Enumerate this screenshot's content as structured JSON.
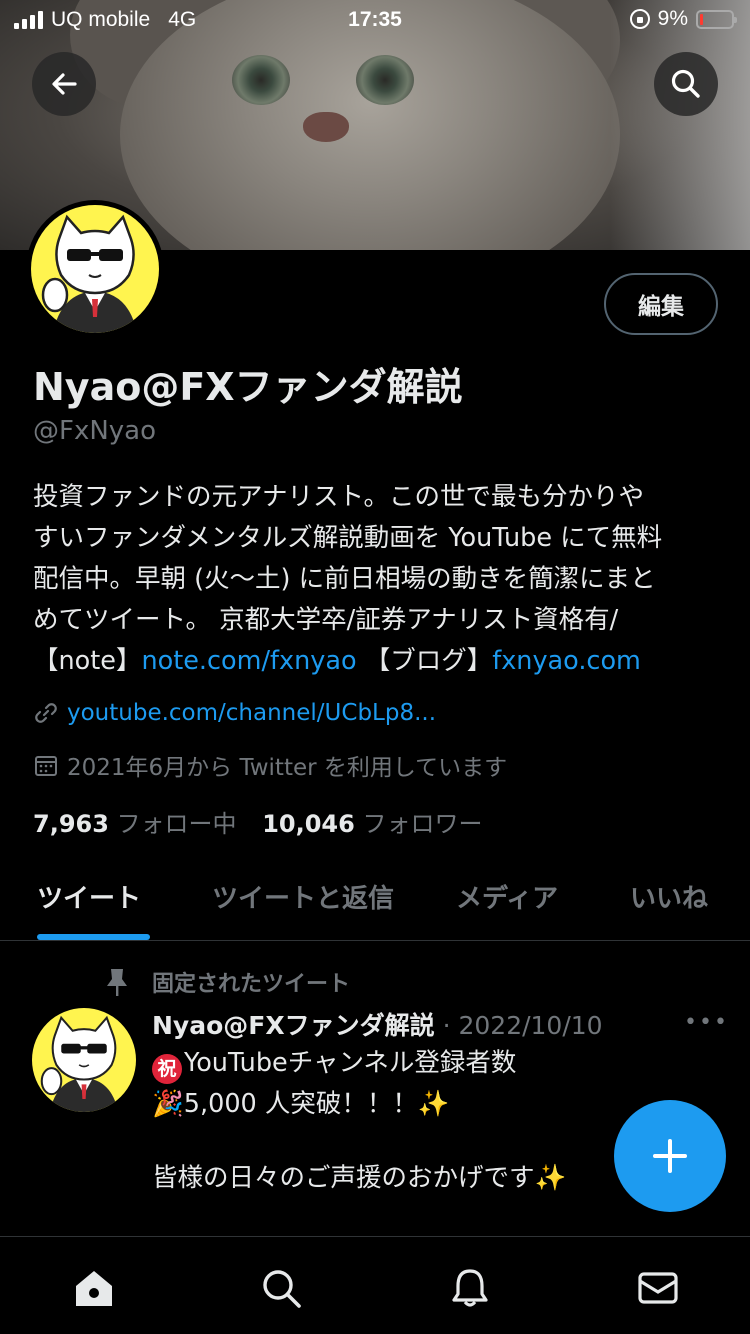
{
  "status_bar": {
    "carrier": "UQ mobile",
    "network": "4G",
    "time": "17:35",
    "battery": "9%",
    "battery_level": 0.09
  },
  "header": {
    "back_icon": "arrow-left-icon",
    "search_icon": "search-icon"
  },
  "profile": {
    "edit_label": "編集",
    "name": "Nyao@FXファンダ解説",
    "handle": "@FxNyao",
    "bio_lines": [
      "投資ファンドの元アナリスト。この世で最も分かりや",
      "すいファンダメンタルズ解説動画を YouTube にて無料",
      "配信中。早朝 (火〜土) に前日相場の動きを簡潔にまと",
      "めてツイート。 京都大学卒/証券アナリスト資格有/"
    ],
    "bio_note_label": "【note】",
    "bio_note_link": "note.com/fxnyao",
    "bio_blog_label": " 【ブログ】",
    "bio_blog_link": "fxnyao.com",
    "website": "youtube.com/channel/UCbLp8...",
    "joined": "2021年6月から Twitter を利用しています",
    "following_count": "7,963",
    "following_label": "フォロー中",
    "followers_count": "10,046",
    "followers_label": "フォロワー"
  },
  "tabs": [
    {
      "label": "ツイート",
      "active": true
    },
    {
      "label": "ツイートと返信",
      "active": false
    },
    {
      "label": "メディア",
      "active": false
    },
    {
      "label": "いいね",
      "active": false
    }
  ],
  "tweet": {
    "pinned_label": "固定されたツイート",
    "author": "Nyao@FXファンダ解説",
    "date": "· 2022/10/10",
    "more": "•••",
    "emoji_celebrate": "祝",
    "line1": "YouTubeチャンネル登録者数",
    "emoji_party": "🎉",
    "line2": "5,000 人突破！！！",
    "emoji_sparkle": "✨",
    "line3": "皆様の日々のご声援のおかげです",
    "emoji_sparkle2": "✨"
  },
  "fab": {
    "icon": "plus-icon"
  },
  "bottom_nav": {
    "items": [
      "home-icon",
      "search-icon",
      "bell-icon",
      "mail-icon"
    ]
  },
  "colors": {
    "accent": "#1d9bf0",
    "background": "#000000",
    "text": "#e7e9ea",
    "muted": "#71767b",
    "avatar_bg": "#fff44f"
  }
}
